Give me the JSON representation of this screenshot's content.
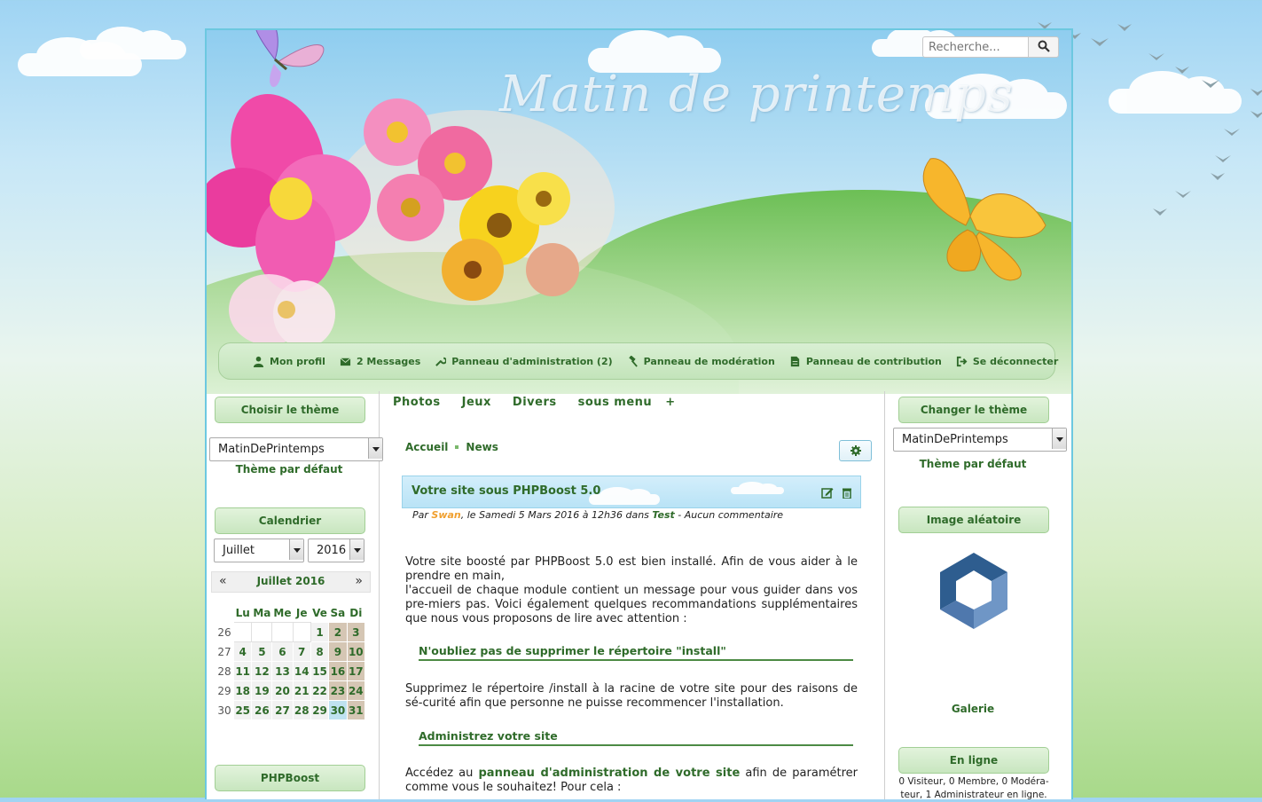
{
  "header": {
    "site_title": "Matin de printemps",
    "search_placeholder": "Recherche...",
    "search_icon": "search-icon"
  },
  "userbar": {
    "items": [
      {
        "label": "Mon profil",
        "icon": "user-icon"
      },
      {
        "label": "2 Messages",
        "icon": "envelope-icon"
      },
      {
        "label": "Panneau d'administration (2)",
        "icon": "wrench-icon"
      },
      {
        "label": "Panneau de modération",
        "icon": "gavel-icon"
      },
      {
        "label": "Panneau de contribution",
        "icon": "file-icon"
      },
      {
        "label": "Se déconnecter",
        "icon": "sign-out-icon"
      }
    ]
  },
  "left": {
    "theme_title": "Choisir le thème",
    "theme_value": "MatinDePrintemps",
    "theme_default": "Thème par défaut",
    "calendar_title": "Calendrier",
    "month_value": "Juillet",
    "year_value": "2016",
    "calendar_header": "Juillet 2016",
    "prev": "«",
    "next": "»",
    "weekdays": [
      "Lu",
      "Ma",
      "Me",
      "Je",
      "Ve",
      "Sa",
      "Di"
    ],
    "weeks": [
      {
        "num": "26",
        "days": [
          "",
          "",
          "",
          "",
          "1",
          "2",
          "3"
        ]
      },
      {
        "num": "27",
        "days": [
          "4",
          "5",
          "6",
          "7",
          "8",
          "9",
          "10"
        ]
      },
      {
        "num": "28",
        "days": [
          "11",
          "12",
          "13",
          "14",
          "15",
          "16",
          "17"
        ]
      },
      {
        "num": "29",
        "days": [
          "18",
          "19",
          "20",
          "21",
          "22",
          "23",
          "24"
        ]
      },
      {
        "num": "30",
        "days": [
          "25",
          "26",
          "27",
          "28",
          "29",
          "30",
          "31"
        ]
      }
    ],
    "today": "30",
    "phpboost_title": "PHPBoost"
  },
  "menu": {
    "items": [
      "Photos",
      "Jeux",
      "Divers",
      "sous menu",
      "+"
    ]
  },
  "breadcrumb": {
    "home": "Accueil",
    "current": "News"
  },
  "article": {
    "title": "Votre site sous PHPBoost 5.0",
    "meta_par": "Par ",
    "author": "Swan",
    "meta_mid": ", le Samedi 5 Mars 2016 à 12h36 dans ",
    "category": "Test",
    "meta_end": " - Aucun commentaire",
    "p1": "Votre site boosté par PHPBoost 5.0 est bien installé. Afin de vous aider à le prendre en main,",
    "p1b": "l'accueil de chaque module contient un message pour vous guider dans vos pre-miers pas. Voici également quelques recommandations supplémentaires que nous vous proposons de lire avec attention :",
    "h1": "N'oubliez pas de supprimer le répertoire \"install\"",
    "p2": "Supprimez le répertoire /install à la racine de votre site pour des raisons de sé-curité afin que personne ne puisse recommencer l'installation.",
    "h2": "Administrez votre site",
    "p3_pre": "Accédez au ",
    "p3_link": "panneau d'administration de votre site",
    "p3_post": " afin de paramétrer comme vous le souhaitez! Pour cela :"
  },
  "right": {
    "theme_title": "Changer le thème",
    "theme_value": "MatinDePrintemps",
    "theme_default": "Thème par défaut",
    "image_title": "Image aléatoire",
    "gallery_label": "Galerie",
    "online_title": "En ligne",
    "online_text": "0 Visiteur, 0 Membre, 0 Modéra-teur, 1 Administrateur en ligne."
  },
  "colors": {
    "accent_green": "#2f6b2a",
    "sky": "#9fd4f3",
    "author_orange": "#f0a030"
  }
}
